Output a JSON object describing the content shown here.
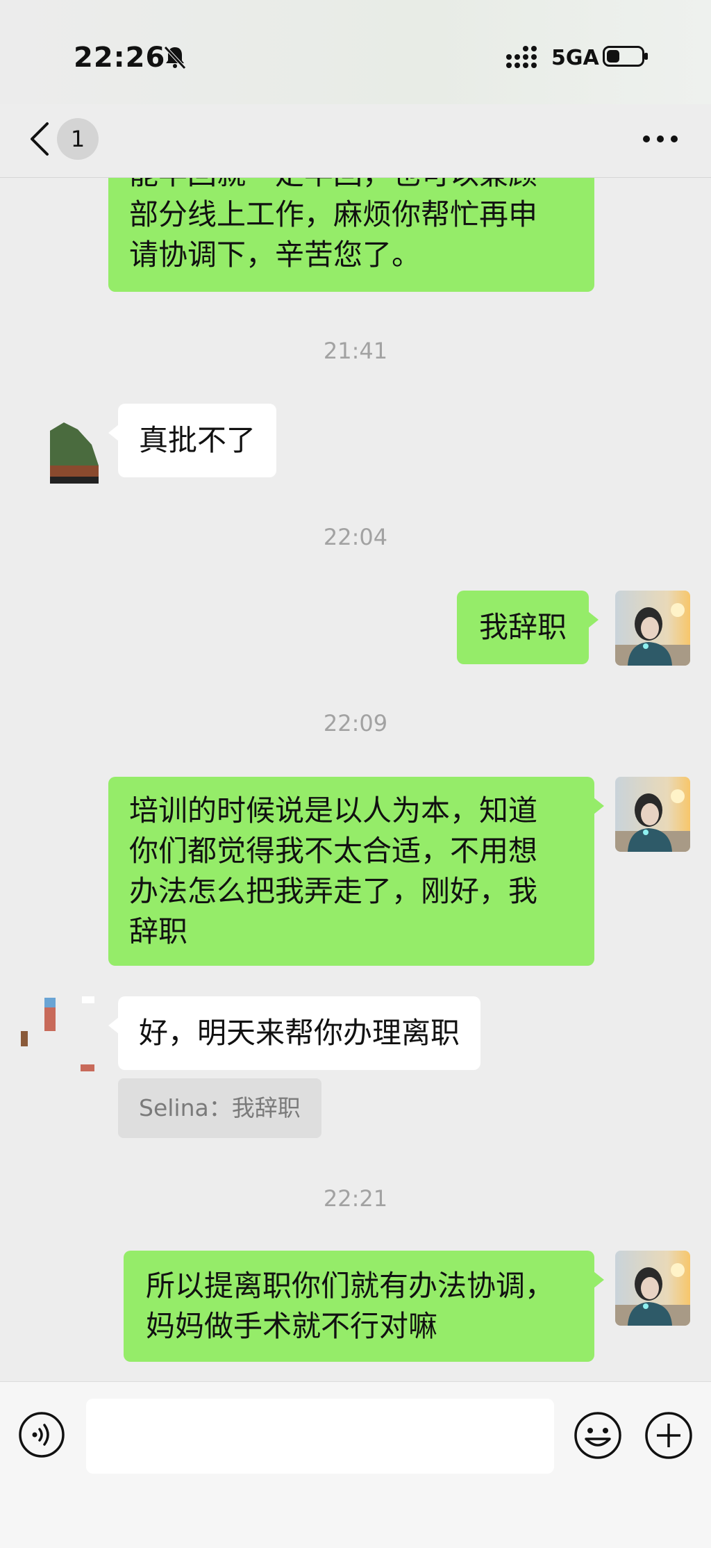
{
  "status_bar": {
    "time": "22:26",
    "network": "5GA",
    "icons": [
      "bell-muted-icon",
      "signal-icon",
      "battery-icon"
    ]
  },
  "nav": {
    "unread_count": "1",
    "icons": [
      "chevron-left-icon",
      "more-icon"
    ]
  },
  "messages": [
    {
      "type": "outgoing",
      "lines": [
        "能半回就一定半回，也可以兼顾",
        "部分线上工作，麻烦你帮忙再申",
        "请协调下，辛苦您了。"
      ]
    },
    {
      "type": "timestamp",
      "text": "21:41"
    },
    {
      "type": "incoming",
      "text": "真批不了"
    },
    {
      "type": "timestamp",
      "text": "22:04"
    },
    {
      "type": "outgoing",
      "text": "我辞职"
    },
    {
      "type": "timestamp",
      "text": "22:09"
    },
    {
      "type": "outgoing",
      "lines": [
        "培训的时候说是以人为本，知道",
        "你们都觉得我不太合适，不用想",
        "办法怎么把我弄走了，刚好，我",
        "辞职"
      ]
    },
    {
      "type": "incoming",
      "text": "好，明天来帮你办理离职",
      "quote": "Selina：我辞职"
    },
    {
      "type": "timestamp",
      "text": "22:21"
    },
    {
      "type": "outgoing",
      "lines": [
        "所以提离职你们就有办法协调，",
        "妈妈做手术就不行对嘛"
      ]
    }
  ],
  "input_bar": {
    "placeholder": "",
    "icons": [
      "voice-icon",
      "emoji-icon",
      "plus-icon"
    ]
  },
  "colors": {
    "outgoing_bubble": "#95ec69",
    "incoming_bubble": "#ffffff",
    "background": "#ededed"
  }
}
